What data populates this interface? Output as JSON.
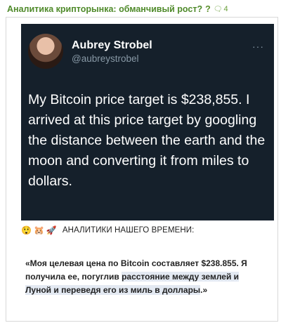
{
  "topic": {
    "title": "Аналитика крипторынка: обманчивый рост?",
    "question_icon": "?",
    "comment_icon": "comment-icon",
    "comment_count": "4"
  },
  "tweet": {
    "name": "Aubrey Strobel",
    "handle": "@aubreystrobel",
    "more": "···",
    "text": "My Bitcoin price target is $238,855. I arrived at this price target by googling the distance between the earth and the moon and converting it from miles to dollars.",
    "bg_color": "#15202b"
  },
  "caption": {
    "emojis": [
      "😲",
      "🐹",
      "🚀"
    ],
    "text": "АНАЛИТИКИ НАШЕГО ВРЕМЕНИ:"
  },
  "quote": {
    "part1": "«Моя целевая цена по Bitcoin составляет $238.855. Я получила ее, погуглив ",
    "highlighted": "расстояние между землей и Луной и переведя его из миль в доллары",
    "part2": ".»"
  }
}
